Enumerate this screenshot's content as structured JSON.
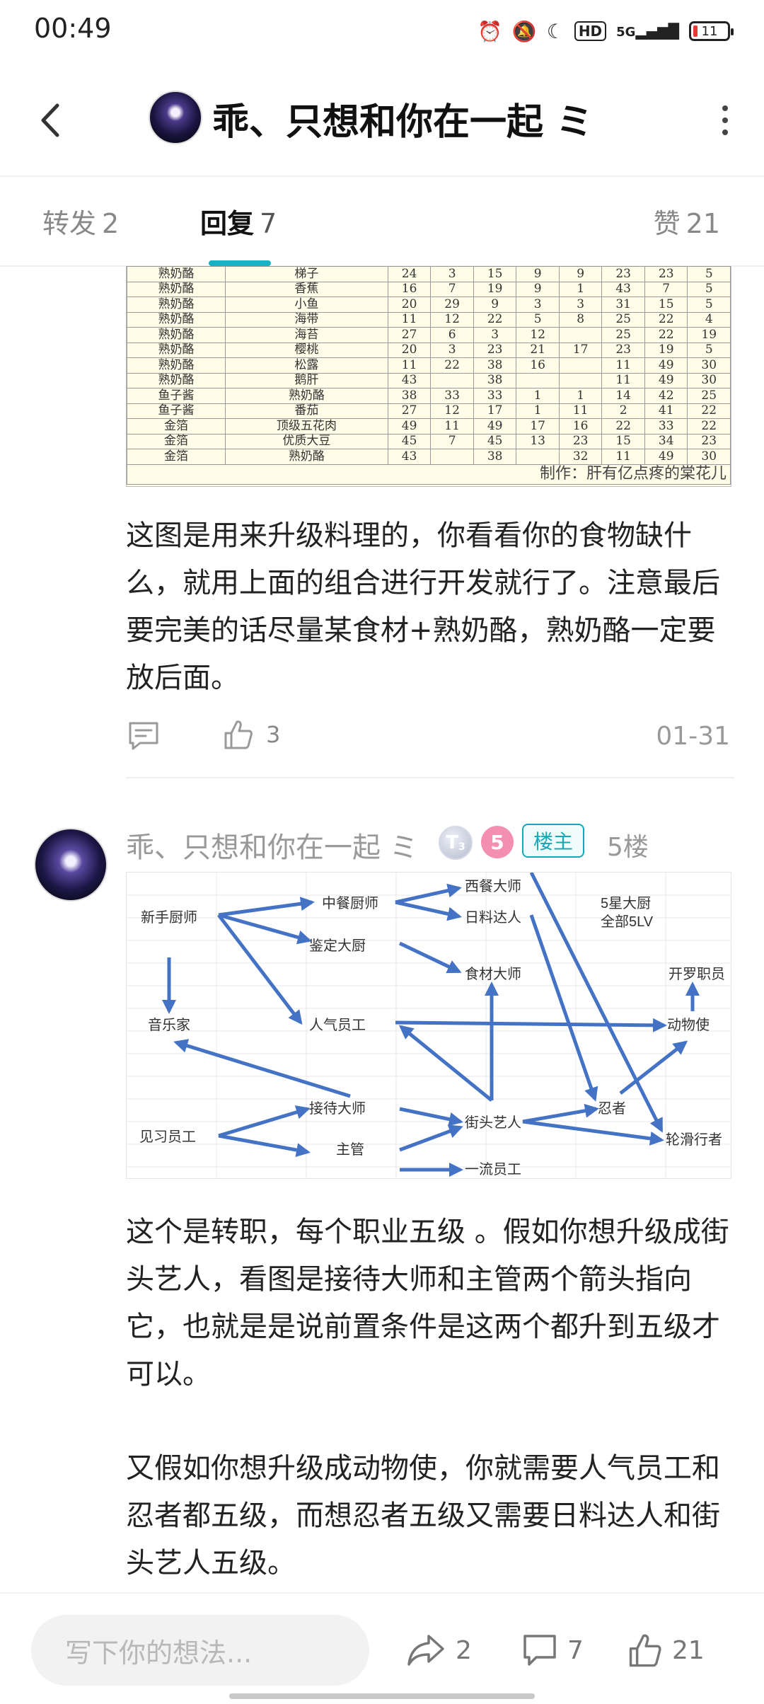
{
  "status_bar": {
    "time": "00:49",
    "network": "5G",
    "hd": "HD",
    "battery": "11"
  },
  "header": {
    "title": "乖、只想和你在一起 ミ"
  },
  "tabs": {
    "forward": {
      "label": "转发",
      "count": "2"
    },
    "reply": {
      "label": "回复",
      "count": "7"
    },
    "like": {
      "label": "赞",
      "count": "21"
    }
  },
  "food_table": {
    "rows": [
      [
        "熟奶酪",
        "梯子",
        "24",
        "3",
        "15",
        "9",
        "9",
        "23",
        "23",
        "5"
      ],
      [
        "熟奶酪",
        "香蕉",
        "16",
        "7",
        "19",
        "9",
        "1",
        "43",
        "7",
        "5"
      ],
      [
        "熟奶酪",
        "小鱼",
        "20",
        "29",
        "9",
        "3",
        "3",
        "31",
        "15",
        "5"
      ],
      [
        "熟奶酪",
        "海带",
        "11",
        "12",
        "22",
        "5",
        "8",
        "25",
        "22",
        "4"
      ],
      [
        "熟奶酪",
        "海苔",
        "27",
        "6",
        "3",
        "12",
        "",
        "25",
        "22",
        "19"
      ],
      [
        "熟奶酪",
        "樱桃",
        "20",
        "3",
        "23",
        "21",
        "17",
        "23",
        "19",
        "5"
      ],
      [
        "熟奶酪",
        "松露",
        "11",
        "22",
        "38",
        "16",
        "",
        "11",
        "49",
        "30"
      ],
      [
        "熟奶酪",
        "鹅肝",
        "43",
        "",
        "38",
        "",
        "",
        "11",
        "49",
        "30"
      ],
      [
        "鱼子酱",
        "熟奶酪",
        "38",
        "33",
        "33",
        "1",
        "1",
        "14",
        "42",
        "25"
      ],
      [
        "鱼子酱",
        "番茄",
        "27",
        "12",
        "17",
        "1",
        "11",
        "2",
        "41",
        "22"
      ],
      [
        "金箔",
        "顶级五花肉",
        "49",
        "11",
        "49",
        "17",
        "16",
        "22",
        "33",
        "22"
      ],
      [
        "金箔",
        "优质大豆",
        "45",
        "7",
        "45",
        "13",
        "23",
        "15",
        "34",
        "23"
      ],
      [
        "金箔",
        "熟奶酪",
        "43",
        "",
        "38",
        "",
        "32",
        "11",
        "49",
        "30"
      ]
    ],
    "credit": "制作：肝有亿点疼的棠花儿"
  },
  "post": {
    "text": "这图是用来升级料理的，你看看你的食物缺什么，就用上面的组合进行开发就行了。注意最后要完美的话尽量某食材+熟奶酪，熟奶酪一定要放后面。",
    "like_count": "3",
    "date": "01-31"
  },
  "reply5": {
    "author": "乖、只想和你在一起 ミ",
    "level_badge": "T",
    "level_sub": "3",
    "lv5_badge": "5",
    "owner_badge": "楼主",
    "floor": "5楼",
    "diagram": {
      "top_note_line1": "5星大厨",
      "top_note_line2": "全部5LV",
      "jobs": {
        "novice_chef": "新手厨师",
        "chinese_chef": "中餐厨师",
        "western_master": "西餐大师",
        "japanese_master": "日料达人",
        "appraise_chef": "鉴定大厨",
        "food_master": "食材大师",
        "musician": "音乐家",
        "popular_staff": "人气员工",
        "animal_envoy": "动物使",
        "kairo_staff": "开罗职员",
        "trainee": "见习员工",
        "reception_master": "接待大师",
        "manager": "主管",
        "street_artist": "街头艺人",
        "ninja": "忍者",
        "skater": "轮滑行者",
        "first_class_staff": "一流员工"
      }
    },
    "para1": "这个是转职，每个职业五级 。假如你想升级成街头艺人，看图是接待大师和主管两个箭头指向它，也就是是说前置条件是这两个都升到五级才可以。",
    "para2": "又假如你想升级成动物使，你就需要人气员工和忍者都五级，而想忍者五级又需要日料达人和街头艺人五级。"
  },
  "bottom_bar": {
    "input_placeholder": "写下你的想法...",
    "share_count": "2",
    "reply_count": "7",
    "like_count": "21"
  },
  "colors": {
    "accent": "#18b2c4",
    "arrow": "#4472c4",
    "table_bg": "#fffde7"
  }
}
